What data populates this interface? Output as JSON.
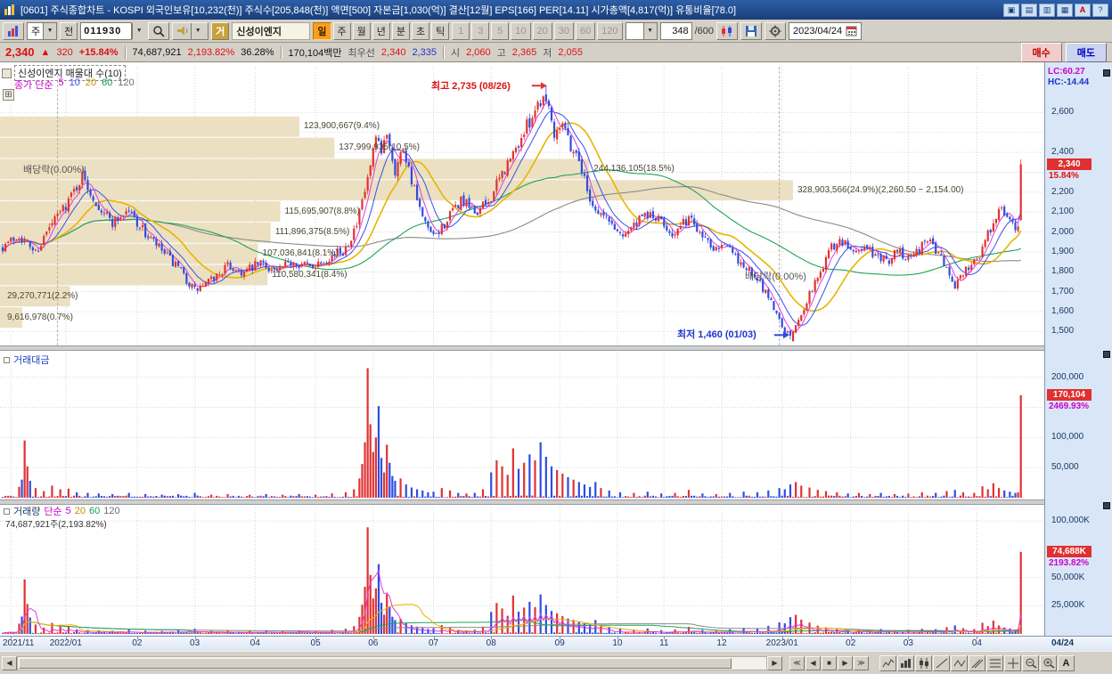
{
  "colors": {
    "up": "#e13232",
    "down": "#2f4de0",
    "ma5": "#e23ce2",
    "ma10": "#3c50e8",
    "ma20": "#e8b400",
    "ma60": "#1fa35a",
    "ma120": "#8a8a8a",
    "profile": "#ece0c2",
    "grid": "#d7d7d7",
    "axis_bg": "#d9e6f7",
    "badge_bg": "#e03030",
    "magenta": "#cc00cc"
  },
  "title_bar": {
    "title": "[0601] 주식종합차트 - KOSPI 외국인보유[10,232(천)] 주식수[205,848(천)] 액면[500] 자본금[1,030(억)] 결산[12월] EPS[166] PER[14.11] 시가총액[4,817(억)] 유통비율[78.0]",
    "icons": [
      "▣",
      "▤",
      "▥",
      "▦",
      "A",
      "?"
    ]
  },
  "toolbar": {
    "period_combo": "주",
    "prev_button": "전",
    "code_input": "011930",
    "flag_button": "거",
    "stock_name": "신성이엔지",
    "period_buttons": [
      "일",
      "주",
      "월",
      "년",
      "분",
      "초",
      "틱"
    ],
    "active_period": "일",
    "minute_buttons": [
      "1",
      "3",
      "5",
      "10",
      "20",
      "30",
      "60",
      "120"
    ],
    "bars_input": "348",
    "bars_total": "/600",
    "date": "2023/04/24"
  },
  "info_row": {
    "price": "2,340",
    "arrow": "▲",
    "change": "320",
    "change_pct": "+15.84%",
    "volume": "74,687,921",
    "volume_pct": "2,193.82%",
    "turnover_pct": "36.28%",
    "amount": "170,104백만",
    "best_label": "최우선",
    "best_ask": "2,340",
    "best_bid": "2,335",
    "open_label": "시",
    "open": "2,060",
    "high_label": "고",
    "high": "2,365",
    "low_label": "저",
    "low": "2,055",
    "buy_button": "매수",
    "sell_button": "매도"
  },
  "chart": {
    "legend_title": "신성이엔지 매물대 수(10)",
    "legend_price": {
      "label": "종가 단순",
      "mas": [
        "5",
        "10",
        "20",
        "60",
        "120"
      ]
    },
    "lc_label": "LC:60.27",
    "hc_label": "HC:-14.44",
    "high_annotation": "최고 2,735 (08/26)",
    "low_annotation": "최저 1,460 (01/03)",
    "ex_div_1": "배당락(0.00%)",
    "ex_div_2": "배당락(0.00%)",
    "price_badge": "2,340",
    "price_badge_pct": "15.84%"
  },
  "amount_panel": {
    "label": "거래대금",
    "badge": "170,104",
    "badge_pct": "2469.93%"
  },
  "volume_panel": {
    "legend": {
      "label": "거래량",
      "simple": "단순",
      "mas": [
        "5",
        "20",
        "60",
        "120"
      ]
    },
    "subtitle": "74,687,921주(2,193.82%)",
    "badge": "74,688K",
    "badge_pct": "2193.82%"
  },
  "x_axis": {
    "last": "04/24"
  },
  "bottom_bar": {
    "scroll_left": "◀",
    "scroll_right": "▶",
    "nav": [
      "≪",
      "◀",
      "■",
      "▶",
      "≫"
    ],
    "font_tool": "A"
  },
  "chart_data": {
    "type": "candlestick",
    "symbol": "신성이엔지",
    "code": "011930",
    "date": "2023/04/24",
    "n_bars": 372,
    "price_scale": {
      "min": 1430,
      "max": 2830,
      "gridlines": [
        1500,
        1600,
        1700,
        1800,
        1900,
        2000,
        2100,
        2200,
        2300,
        2400,
        2500,
        2600
      ]
    },
    "axis_price_labels": [
      {
        "text": "2,600",
        "value": 2600
      },
      {
        "text": "2,400",
        "value": 2400
      },
      {
        "text": "2,200",
        "value": 2200
      },
      {
        "text": "2,100",
        "value": 2100
      },
      {
        "text": "2,000",
        "value": 2000
      },
      {
        "text": "1,900",
        "value": 1900
      },
      {
        "text": "1,800",
        "value": 1800
      },
      {
        "text": "1,700",
        "value": 1700
      },
      {
        "text": "1,600",
        "value": 1600
      },
      {
        "text": "1,500",
        "value": 1500
      }
    ],
    "close_keyframes": [
      [
        0,
        1930
      ],
      [
        6,
        1985
      ],
      [
        12,
        1900
      ],
      [
        18,
        2040
      ],
      [
        24,
        2160
      ],
      [
        29,
        2280
      ],
      [
        34,
        2150
      ],
      [
        40,
        2050
      ],
      [
        46,
        2110
      ],
      [
        52,
        1990
      ],
      [
        58,
        1905
      ],
      [
        64,
        1815
      ],
      [
        70,
        1705
      ],
      [
        76,
        1755
      ],
      [
        82,
        1830
      ],
      [
        88,
        1795
      ],
      [
        94,
        1845
      ],
      [
        100,
        1800
      ],
      [
        106,
        1855
      ],
      [
        112,
        1825
      ],
      [
        118,
        1870
      ],
      [
        124,
        1905
      ],
      [
        129,
        2030
      ],
      [
        133,
        2260
      ],
      [
        136,
        2460
      ],
      [
        138,
        2390
      ],
      [
        140,
        2510
      ],
      [
        143,
        2310
      ],
      [
        146,
        2430
      ],
      [
        150,
        2210
      ],
      [
        153,
        2060
      ],
      [
        157,
        1965
      ],
      [
        162,
        2060
      ],
      [
        167,
        2160
      ],
      [
        172,
        2095
      ],
      [
        177,
        2150
      ],
      [
        182,
        2290
      ],
      [
        186,
        2390
      ],
      [
        191,
        2530
      ],
      [
        195,
        2650
      ],
      [
        198,
        2690
      ],
      [
        201,
        2500
      ],
      [
        204,
        2570
      ],
      [
        207,
        2430
      ],
      [
        210,
        2370
      ],
      [
        213,
        2210
      ],
      [
        216,
        2110
      ],
      [
        220,
        2070
      ],
      [
        225,
        1990
      ],
      [
        230,
        2030
      ],
      [
        235,
        2090
      ],
      [
        240,
        2050
      ],
      [
        245,
        1985
      ],
      [
        250,
        2075
      ],
      [
        255,
        1990
      ],
      [
        259,
        1930
      ],
      [
        263,
        1950
      ],
      [
        267,
        1870
      ],
      [
        271,
        1820
      ],
      [
        275,
        1750
      ],
      [
        279,
        1680
      ],
      [
        283,
        1560
      ],
      [
        287,
        1460
      ],
      [
        290,
        1560
      ],
      [
        294,
        1690
      ],
      [
        298,
        1800
      ],
      [
        302,
        1930
      ],
      [
        306,
        1950
      ],
      [
        310,
        1900
      ],
      [
        314,
        1930
      ],
      [
        318,
        1880
      ],
      [
        322,
        1850
      ],
      [
        326,
        1905
      ],
      [
        330,
        1880
      ],
      [
        334,
        1920
      ],
      [
        338,
        1960
      ],
      [
        342,
        1870
      ],
      [
        347,
        1735
      ],
      [
        351,
        1820
      ],
      [
        355,
        1870
      ],
      [
        358,
        1950
      ],
      [
        361,
        2060
      ],
      [
        364,
        2110
      ],
      [
        367,
        2050
      ],
      [
        370,
        2020
      ],
      [
        371,
        2340
      ]
    ],
    "overrides": {
      "198": {
        "high": 2735
      },
      "287": {
        "low": 1460,
        "close": 1480
      },
      "371": {
        "open": 2060,
        "high": 2365,
        "low": 2055,
        "close": 2340
      }
    },
    "high_point": {
      "bar": 198,
      "price": 2735,
      "label": "최고 2,735 (08/26)"
    },
    "low_point": {
      "bar": 287,
      "price": 1460,
      "label": "최저 1,460 (01/03)"
    },
    "ex_dividend": [
      {
        "bar": 20,
        "label": "배당락(0.00%)"
      },
      {
        "bar": 283,
        "label": "배당락(0.00%)"
      }
    ],
    "volume_profile": {
      "price_top": 2580,
      "band_size": 106.5,
      "max_pct": 24.9,
      "max_width": 890,
      "bands": [
        {
          "value": "123,900,667(9.4%)",
          "pct": 9.4
        },
        {
          "value": "137,999,935(10.5%)",
          "pct": 10.5
        },
        {
          "value": "244,136,105(18.5%)",
          "pct": 18.5
        },
        {
          "value": "328,903,566(24.9%)(2,260.50 ~ 2,154.00)",
          "pct": 24.9
        },
        {
          "value": "115,695,907(8.8%)",
          "pct": 8.8
        },
        {
          "value": "111,896,375(8.5%)",
          "pct": 8.5
        },
        {
          "value": "107,036,841(8.1%)",
          "pct": 8.1
        },
        {
          "value": "110,580,341(8.4%)",
          "pct": 8.4
        },
        {
          "value": "29,270,771(2.2%)",
          "pct": 2.2
        },
        {
          "value": "9,616,978(0.7%)",
          "pct": 0.7
        }
      ]
    },
    "months": [
      [
        3,
        "2021/11"
      ],
      [
        23,
        "2022/01"
      ],
      [
        49,
        "02"
      ],
      [
        70,
        "03"
      ],
      [
        92,
        "04"
      ],
      [
        114,
        "05"
      ],
      [
        135,
        "06"
      ],
      [
        157,
        "07"
      ],
      [
        178,
        "08"
      ],
      [
        203,
        "09"
      ],
      [
        224,
        "10"
      ],
      [
        241,
        "11"
      ],
      [
        262,
        "12"
      ],
      [
        284,
        "2023/01"
      ],
      [
        309,
        "02"
      ],
      [
        330,
        "03"
      ],
      [
        355,
        "04"
      ]
    ],
    "amount_scale": {
      "max": 235000,
      "gridlines": [
        50000,
        100000,
        150000,
        200000
      ],
      "labels": [
        {
          "text": "200,000",
          "value": 200000
        },
        {
          "text": "100,000",
          "value": 100000
        },
        {
          "text": "50,000",
          "value": 50000
        }
      ]
    },
    "volume_scale": {
      "max": 112000,
      "gridlines": [
        25000,
        50000,
        100000
      ],
      "labels": [
        {
          "text": "100,000K",
          "value": 100000
        },
        {
          "text": "50,000K",
          "value": 50000
        },
        {
          "text": "25,000K",
          "value": 25000
        }
      ]
    },
    "amount_spikes": {
      "6": 18000,
      "7": 30000,
      "8": 95000,
      "9": 52000,
      "10": 28000,
      "12": 16000,
      "15": 11000,
      "18": 20000,
      "21": 14000,
      "24": 15000,
      "27": 9000,
      "31": 8000,
      "35": 7000,
      "40": 6000,
      "46": 8000,
      "52": 6000,
      "58": 5000,
      "64": 6000,
      "70": 8000,
      "76": 5000,
      "82": 6000,
      "90": 5000,
      "96": 6000,
      "102": 5000,
      "108": 6000,
      "114": 5000,
      "120": 7000,
      "125": 9000,
      "128": 14000,
      "130": 32000,
      "131": 56000,
      "132": 92000,
      "133": 215000,
      "134": 122000,
      "135": 76000,
      "136": 100000,
      "137": 152000,
      "138": 66000,
      "139": 42000,
      "140": 88000,
      "141": 58000,
      "142": 36000,
      "143": 28000,
      "145": 32000,
      "147": 22000,
      "149": 17000,
      "151": 14000,
      "153": 12000,
      "155": 9000,
      "157": 10000,
      "160": 16000,
      "163": 12000,
      "166": 8000,
      "169": 7000,
      "172": 8000,
      "175": 14000,
      "178": 42000,
      "180": 62000,
      "182": 52000,
      "184": 38000,
      "186": 82000,
      "188": 48000,
      "190": 58000,
      "192": 72000,
      "194": 62000,
      "196": 92000,
      "198": 68000,
      "200": 52000,
      "202": 46000,
      "204": 40000,
      "206": 34000,
      "208": 30000,
      "210": 26000,
      "212": 22000,
      "214": 18000,
      "216": 26000,
      "218": 16000,
      "221": 12000,
      "225": 9000,
      "230": 8000,
      "235": 10000,
      "240": 7000,
      "245": 8000,
      "250": 13000,
      "255": 7000,
      "260": 6000,
      "265": 8000,
      "270": 10000,
      "275": 9000,
      "279": 12000,
      "283": 16000,
      "285": 14000,
      "287": 22000,
      "289": 26000,
      "291": 20000,
      "294": 17000,
      "297": 13000,
      "300": 11000,
      "304": 9000,
      "308": 7000,
      "312": 8000,
      "316": 6000,
      "320": 8000,
      "325": 6000,
      "330": 7000,
      "335": 9000,
      "340": 8000,
      "344": 11000,
      "347": 13000,
      "350": 9000,
      "354": 8000,
      "357": 19000,
      "359": 14000,
      "361": 24000,
      "363": 16000,
      "365": 12000,
      "367": 10000,
      "369": 8000,
      "370": 9000,
      "371": 170104
    },
    "current": {
      "price": 2340,
      "amount": 170104,
      "volume_k": 72694
    }
  }
}
